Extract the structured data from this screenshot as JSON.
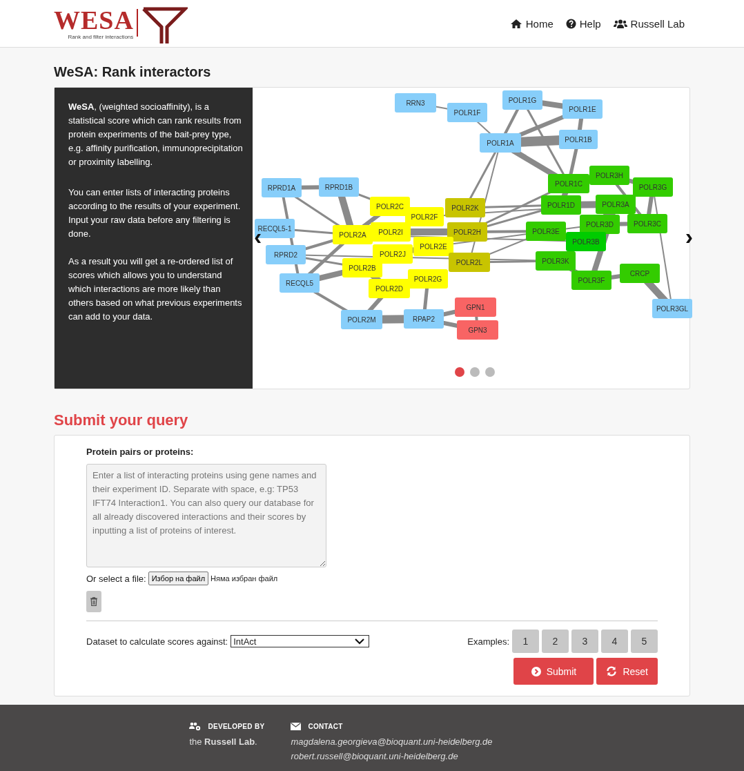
{
  "header": {
    "logo": {
      "wordmark": "WESA",
      "tagline": "Rank and filter interactions"
    },
    "nav": [
      {
        "label": "Home"
      },
      {
        "label": "Help"
      },
      {
        "label": "Russell Lab"
      }
    ]
  },
  "page_title": "WeSA: Rank interactors",
  "intro": {
    "paragraphs": [
      "**WeSA**, (weighted socioaffinity), is a statistical score which can rank results from protein experiments of the bait-prey type, e.g. affinity purification, immunoprecipitation or proximity labelling.",
      "You can enter lists of interacting proteins according to the results of your experiment. Input your raw data before any filtering is done.",
      "As a result you will get a re-ordered list of scores which allows you to understand which interactions are more likely than others based on what previous experiments can add to your data."
    ]
  },
  "carousel": {
    "prev": "‹",
    "next": "›",
    "indicators": [
      {
        "selected": true
      },
      {
        "selected": false
      },
      {
        "selected": false
      }
    ],
    "network_nodes": [
      {
        "label": "RRN3",
        "color": "#87cefa"
      },
      {
        "label": "POLR1F",
        "color": "#87cefa"
      },
      {
        "label": "POLR1G",
        "color": "#87cefa"
      },
      {
        "label": "POLR1E",
        "color": "#87cefa"
      },
      {
        "label": "POLR1A",
        "color": "#87cefa"
      },
      {
        "label": "POLR1B",
        "color": "#87cefa"
      },
      {
        "label": "RPRD1A",
        "color": "#87cefa"
      },
      {
        "label": "RPRD1B",
        "color": "#87cefa"
      },
      {
        "label": "RECQL5-1",
        "color": "#87cefa"
      },
      {
        "label": "RPRD2",
        "color": "#87cefa"
      },
      {
        "label": "RECQL5",
        "color": "#87cefa"
      },
      {
        "label": "POLR2C",
        "color": "#ffff00"
      },
      {
        "label": "POLR2F",
        "color": "#ffff00"
      },
      {
        "label": "POLR2K",
        "color": "#c8c400"
      },
      {
        "label": "POLR2A",
        "color": "#ffff00"
      },
      {
        "label": "POLR2I",
        "color": "#ffff00"
      },
      {
        "label": "POLR2H",
        "color": "#c8c400"
      },
      {
        "label": "POLR2E",
        "color": "#ffff00"
      },
      {
        "label": "POLR2J",
        "color": "#ffff00"
      },
      {
        "label": "POLR2B",
        "color": "#ffff00"
      },
      {
        "label": "POLR2L",
        "color": "#c8c400"
      },
      {
        "label": "POLR2G",
        "color": "#ffff00"
      },
      {
        "label": "POLR2D",
        "color": "#ffff00"
      },
      {
        "label": "GPN1",
        "color": "#f86464"
      },
      {
        "label": "GPN3",
        "color": "#f86464"
      },
      {
        "label": "POLR2M",
        "color": "#87cefa"
      },
      {
        "label": "RPAP2",
        "color": "#87cefa"
      },
      {
        "label": "POLR1C",
        "color": "#33cc00"
      },
      {
        "label": "POLR3H",
        "color": "#33cc00"
      },
      {
        "label": "POLR3G",
        "color": "#33cc00"
      },
      {
        "label": "POLR1D",
        "color": "#33cc00"
      },
      {
        "label": "POLR3A",
        "color": "#33cc00"
      },
      {
        "label": "POLR3D",
        "color": "#33cc00"
      },
      {
        "label": "POLR3C",
        "color": "#33cc00"
      },
      {
        "label": "POLR3E",
        "color": "#33cc00"
      },
      {
        "label": "POLR3B",
        "color": "#00cc00"
      },
      {
        "label": "POLR3K",
        "color": "#33cc00"
      },
      {
        "label": "POLR3F",
        "color": "#33cc00"
      },
      {
        "label": "CRCP",
        "color": "#33cc00"
      },
      {
        "label": "POLR3GL",
        "color": "#87cefa"
      }
    ]
  },
  "submit_title": "Submit your query",
  "form": {
    "input_label": "Protein pairs or proteins:",
    "placeholder": "Enter a list of interacting proteins using gene names and their experiment ID. Separate with space, e.g: TP53 IFT74 Interaction1. You can also query our database for all already discovered interactions and their scores by inputting a list of proteins of interest.",
    "file_label": "Or select a file:",
    "file_button": "Избор на файл",
    "file_status": "Няма избран файл",
    "dataset_label": "Dataset to calculate scores against:",
    "dataset_value": "IntAct",
    "examples_label": "Examples:",
    "examples": [
      "1",
      "2",
      "3",
      "4",
      "5"
    ],
    "submit": "Submit",
    "reset": "Reset"
  },
  "footer": {
    "developed_heading": "DEVELOPED BY",
    "developed_text": "the **Russell Lab**.",
    "contact_heading": "CONTACT",
    "emails": [
      "magdalena.georgieva@bioquant.uni-heidelberg.de",
      "robert.russell@bioquant.uni-heidelberg.de"
    ]
  }
}
